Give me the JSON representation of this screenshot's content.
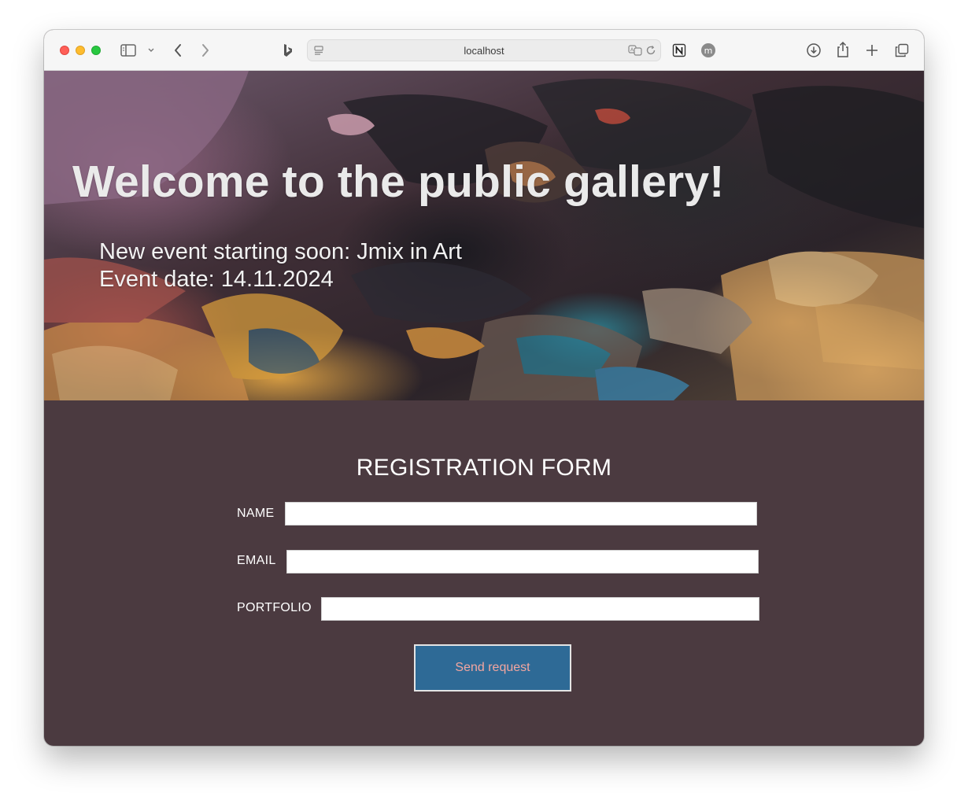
{
  "browser": {
    "url": "localhost",
    "icons": [
      "sidebar-icon",
      "chevron-down-icon",
      "back-icon",
      "forward-icon",
      "bing-icon",
      "site-settings-icon",
      "translate-icon",
      "reload-icon",
      "notion-icon",
      "profile-icon",
      "download-icon",
      "share-icon",
      "new-tab-icon",
      "tabs-overview-icon"
    ]
  },
  "hero": {
    "title": "Welcome to the public gallery!",
    "event_line": "New event starting soon: Jmix in Art",
    "date_line": "Event date: 14.11.2024"
  },
  "form": {
    "title": "REGISTRATION FORM",
    "name_label": "NAME",
    "name_value": "",
    "email_label": "EMAIL",
    "email_value": "",
    "portfolio_label": "PORTFOLIO",
    "portfolio_value": "",
    "submit_label": "Send request"
  },
  "colors": {
    "page_background": "#4b3a40",
    "button_background": "#2e6a96",
    "button_text": "#f3a6a0",
    "text": "#ffffff"
  }
}
